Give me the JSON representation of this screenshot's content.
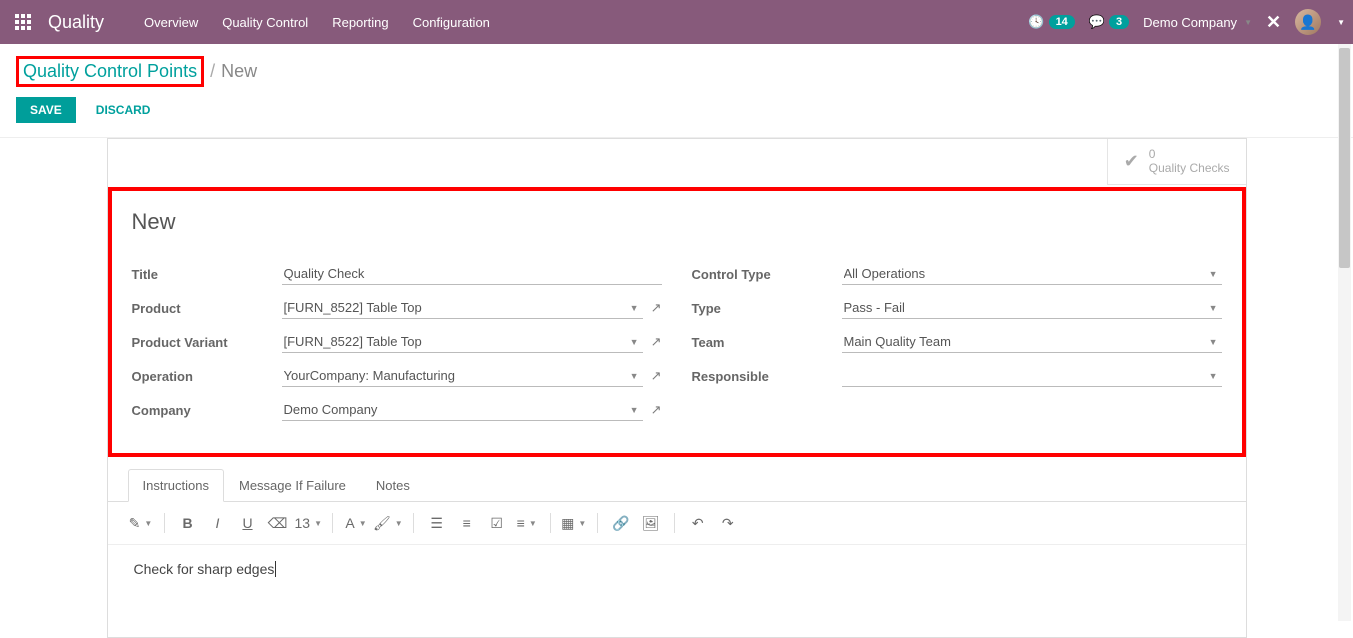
{
  "topbar": {
    "app_title": "Quality",
    "nav": [
      "Overview",
      "Quality Control",
      "Reporting",
      "Configuration"
    ],
    "clock_badge": "14",
    "chat_badge": "3",
    "company": "Demo Company"
  },
  "breadcrumb": {
    "parent": "Quality Control Points",
    "current": "New"
  },
  "actions": {
    "save": "SAVE",
    "discard": "DISCARD"
  },
  "stat": {
    "count": "0",
    "label": "Quality Checks"
  },
  "form": {
    "heading": "New",
    "left": {
      "title_label": "Title",
      "title_value": "Quality Check",
      "product_label": "Product",
      "product_value": "[FURN_8522] Table Top",
      "variant_label": "Product Variant",
      "variant_value": "[FURN_8522] Table Top",
      "operation_label": "Operation",
      "operation_value": "YourCompany: Manufacturing",
      "company_label": "Company",
      "company_value": "Demo Company"
    },
    "right": {
      "control_type_label": "Control Type",
      "control_type_value": "All Operations",
      "type_label": "Type",
      "type_value": "Pass - Fail",
      "team_label": "Team",
      "team_value": "Main Quality Team",
      "responsible_label": "Responsible",
      "responsible_value": ""
    }
  },
  "tabs": [
    "Instructions",
    "Message If Failure",
    "Notes"
  ],
  "toolbar": {
    "font_size": "13"
  },
  "editor": {
    "content": "Check for sharp edges"
  }
}
